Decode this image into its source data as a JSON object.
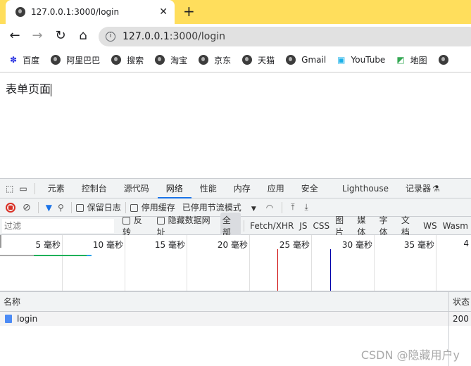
{
  "browser": {
    "tab_title": "127.0.0.1:3000/login",
    "url_host": "127.0.0.1",
    "url_rest": ":3000/login",
    "bookmarks": [
      "百度",
      "阿里巴巴",
      "搜索",
      "淘宝",
      "京东",
      "天猫",
      "Gmail",
      "YouTube",
      "地图"
    ]
  },
  "page": {
    "text": "表单页面"
  },
  "devtools": {
    "tabs": [
      "元素",
      "控制台",
      "源代码",
      "网络",
      "性能",
      "内存",
      "应用",
      "安全",
      "Lighthouse",
      "记录器"
    ],
    "active_tab": "网络",
    "toolbar": {
      "preserve_log": "保留日志",
      "disable_cache": "停用缓存",
      "throttle": "已停用节流模式"
    },
    "filter": {
      "placeholder": "过滤",
      "invert": "反转",
      "hide_data_urls": "隐藏数据网址",
      "types": [
        "全部",
        "Fetch/XHR",
        "JS",
        "CSS",
        "图片",
        "媒体",
        "字体",
        "文档",
        "WS",
        "Wasm"
      ]
    },
    "timeline_labels": [
      "5 毫秒",
      "10 毫秒",
      "15 毫秒",
      "20 毫秒",
      "25 毫秒",
      "30 毫秒",
      "35 毫秒",
      "4"
    ],
    "columns": {
      "name": "名称",
      "status": "状态"
    },
    "rows": [
      {
        "name": "login",
        "status": "200"
      }
    ]
  },
  "watermark": "CSDN @隐藏用户y"
}
